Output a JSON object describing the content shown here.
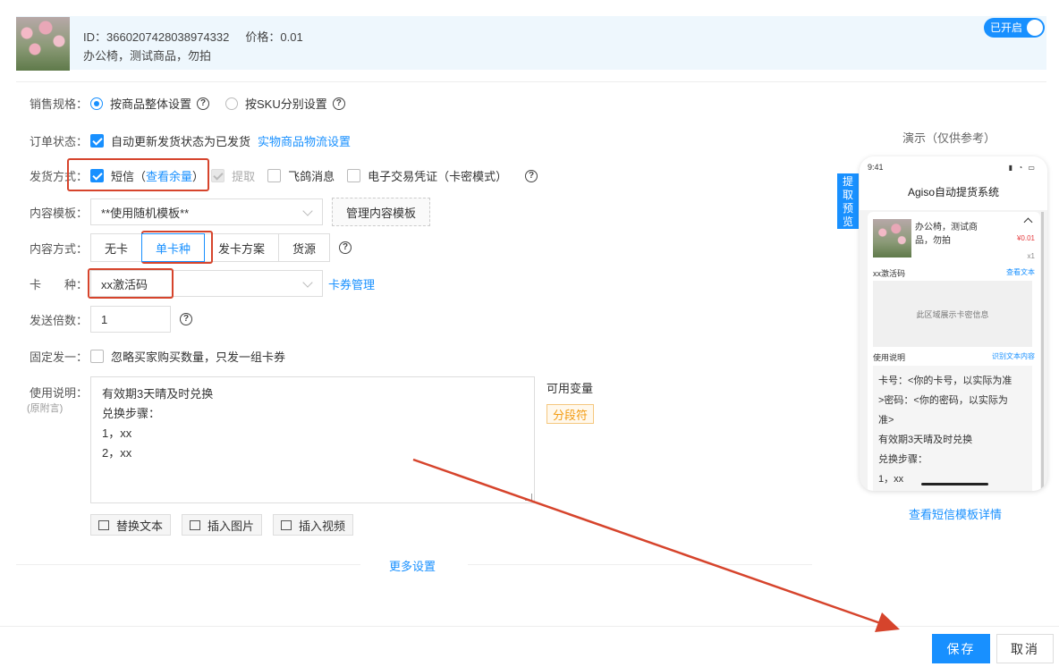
{
  "header": {
    "id_label": "ID：3660207428038974332",
    "price_label": "价格：0.01",
    "product_name": "办公椅，测试商品，勿拍",
    "toggle_label": "已开启"
  },
  "form": {
    "sale_spec": {
      "label": "销售规格：",
      "option1": "按商品整体设置",
      "option2": "按SKU分别设置"
    },
    "order_status": {
      "label": "订单状态：",
      "checkbox_text": "自动更新发货状态为已发货",
      "link": "实物商品物流设置"
    },
    "delivery": {
      "label": "发货方式：",
      "sms": "短信",
      "check_balance": "查看余量",
      "pickup": "提取",
      "feige": "飞鸽消息",
      "voucher": "电子交易凭证（卡密模式）"
    },
    "template": {
      "label": "内容模板：",
      "value": "**使用随机模板**",
      "manage_button": "管理内容模板"
    },
    "content_mode": {
      "label": "内容方式：",
      "options": [
        "无卡",
        "单卡种",
        "发卡方案",
        "货源"
      ],
      "selected": "单卡种"
    },
    "card_type": {
      "label": "卡　　种：",
      "value": "xx激活码",
      "link": "卡券管理"
    },
    "multiplier": {
      "label": "发送倍数：",
      "value": "1"
    },
    "fixed_one": {
      "label": "固定发一：",
      "text": "忽略买家购买数量，只发一组卡券"
    },
    "usage": {
      "label": "使用说明：",
      "sub_label": "(原附言)",
      "lines": [
        "有效期3天晴及时兑换",
        "兑换步骤：",
        "1，xx",
        "2，xx"
      ],
      "variables_title": "可用变量",
      "variable_tag": "分段符",
      "toolbar": {
        "replace": "替换文本",
        "insert_image": "插入图片",
        "insert_video": "插入视频"
      }
    },
    "more_settings": "更多设置"
  },
  "preview": {
    "title": "演示（仅供参考）",
    "side_tab": "提取预览",
    "status_time": "9:41",
    "app_title": "Agiso自动提货系统",
    "product_name": "办公椅，测试商品，勿拍",
    "price": "¥0.01",
    "qty": "x1",
    "card_section": "xx激活码",
    "view_text": "查看文本",
    "card_area_text": "此区域展示卡密信息",
    "usage_section": "使用说明",
    "recognize_link": "识别文本内容",
    "usage_lines": [
      "卡号：<你的卡号，以实际为准",
      ">密码：<你的密码，以实际为",
      "准>",
      "有效期3天晴及时兑换",
      "兑换步骤：",
      "1，xx"
    ],
    "sms_detail_link": "查看短信模板详情"
  },
  "footer": {
    "save": "保存",
    "cancel": "取消"
  },
  "colors": {
    "primary": "#1890ff",
    "highlight": "#d6442c",
    "tag": "#f39c12"
  }
}
